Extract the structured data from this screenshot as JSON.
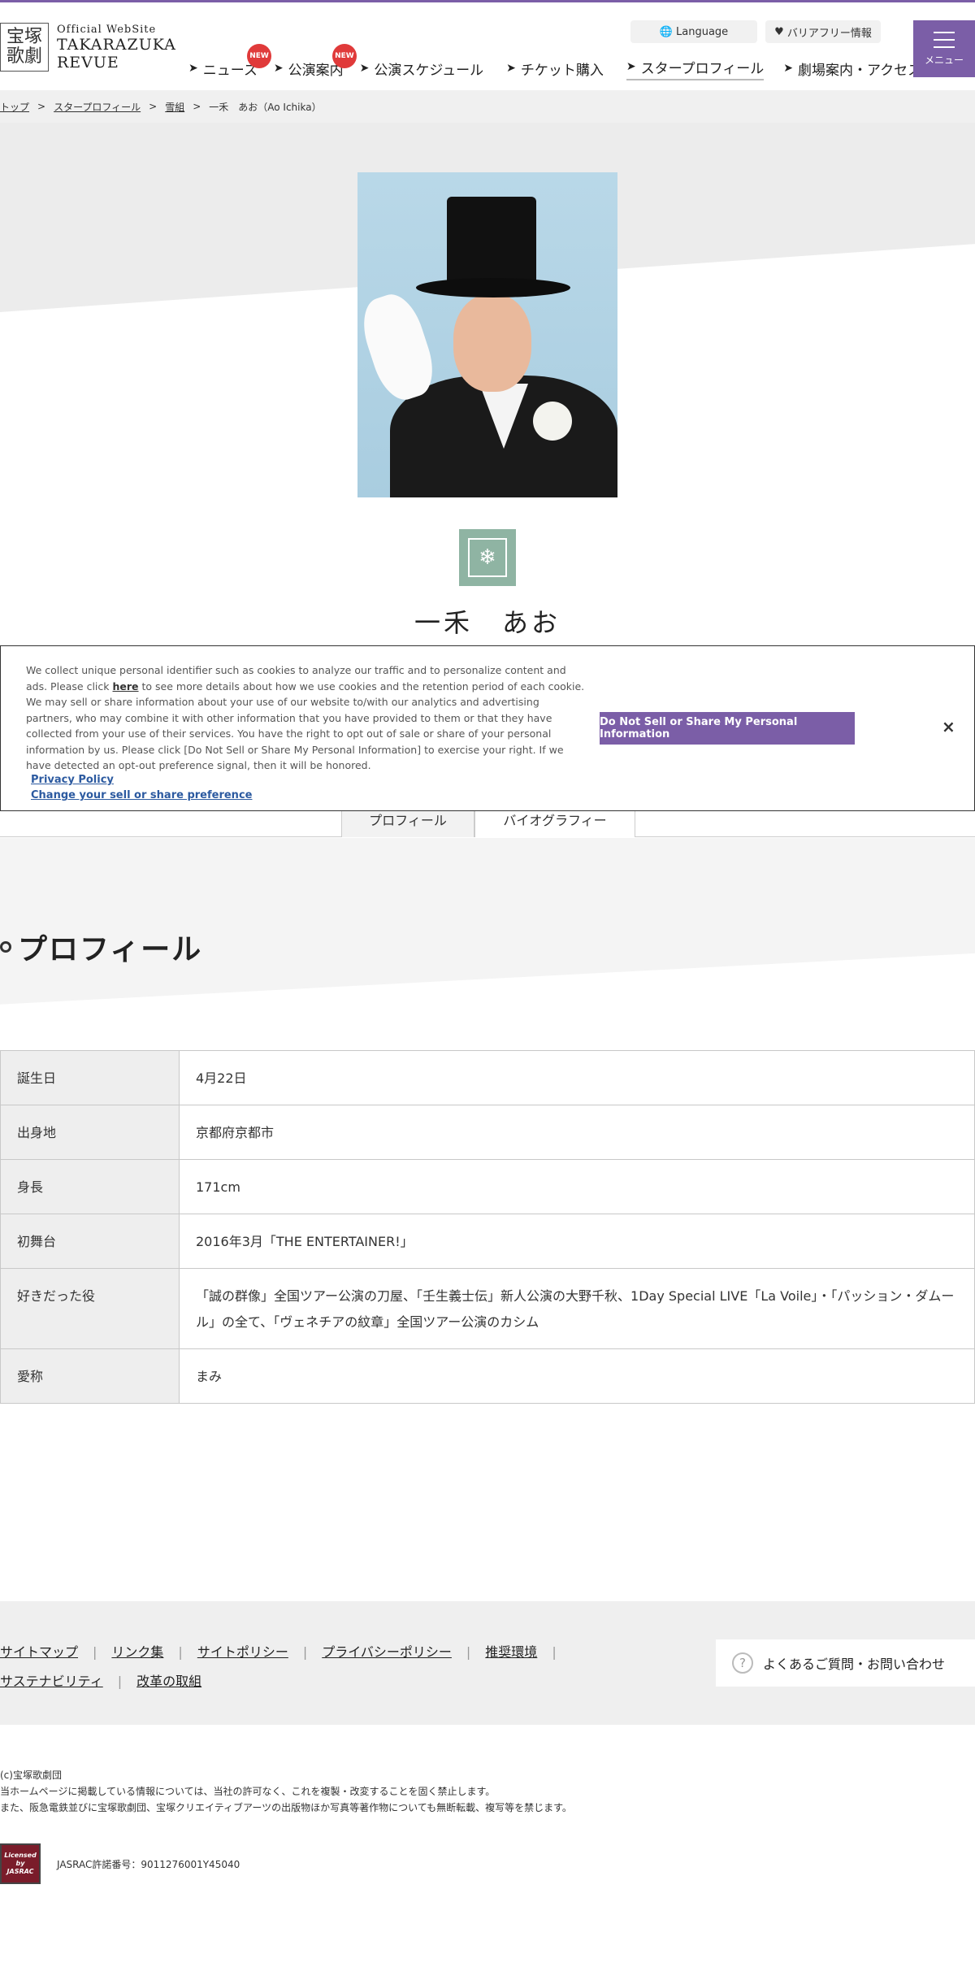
{
  "header": {
    "logo_kanji": "宝塚歌劇",
    "logo_sub": "Official WebSite",
    "logo_line1": "TAKARAZUKA",
    "logo_line2": "REVUE",
    "language_label": "Language",
    "barrier_free_label": "バリアフリー情報",
    "menu_label": "メニュー",
    "nav": [
      {
        "label": "ニュース",
        "badge": "NEW"
      },
      {
        "label": "公演案内",
        "badge": "NEW"
      },
      {
        "label": "公演スケジュール"
      },
      {
        "label": "チケット購入"
      },
      {
        "label": "スタープロフィール"
      },
      {
        "label": "劇場案内・アクセス"
      }
    ]
  },
  "breadcrumb": [
    "トップ",
    "スタープロフィール",
    "雪組",
    "一禾　あお（Ao Ichika）"
  ],
  "star": {
    "name": "一禾　あお"
  },
  "cookie": {
    "text_before": "We collect unique personal identifier such as cookies to analyze our traffic and to personalize content and ads. Please click ",
    "here": "here",
    "text_after": " to see more details about how we use cookies and the retention period of each cookie. We may sell or share information about your use of our website to/with our analytics and advertising partners, who may combine it with other information that you have provided to them or that they have collected from your use of their services. You have the right to opt out of sale or share of your personal information by us. Please click [Do Not Sell or Share My Personal Information] to exercise your right. If we have detected an opt-out preference signal, then it will be honored.",
    "privacy_link": "Privacy Policy",
    "preference_link": "Change your sell or share preference",
    "button": "Do Not Sell or Share My Personal Information",
    "close": "×"
  },
  "tabs": [
    "プロフィール",
    "バイオグラフィー"
  ],
  "section_title": "プロフィール",
  "profile": [
    {
      "key": "誕生日",
      "value": "4月22日"
    },
    {
      "key": "出身地",
      "value": "京都府京都市"
    },
    {
      "key": "身長",
      "value": "171cm"
    },
    {
      "key": "初舞台",
      "value": "2016年3月「THE ENTERTAINER!」"
    },
    {
      "key": "好きだった役",
      "value": "「誠の群像」全国ツアー公演の刀屋、「壬生義士伝」新人公演の大野千秋、1Day Special LIVE「La Voile」・「パッション・ダムール」の全て、「ヴェネチアの紋章」全国ツアー公演のカシム"
    },
    {
      "key": "愛称",
      "value": "まみ"
    }
  ],
  "footer": {
    "links": [
      "サイトマップ",
      "リンク集",
      "サイトポリシー",
      "プライバシーポリシー",
      "推奨環境",
      "サステナビリティ",
      "改革の取組"
    ],
    "faq": "よくあるご質問・お問い合わせ",
    "copyright": [
      "(c)宝塚歌劇団",
      "当ホームページに掲載している情報については、当社の許可なく、これを複製・改変することを固く禁止します。",
      "また、阪急電鉄並びに宝塚歌劇団、宝塚クリエイティブアーツの出版物ほか写真等著作物についても無断転載、複写等を禁じます。"
    ],
    "jasrac_logo": "Licensed by JASRAC",
    "jasrac": "JASRAC許諾番号：9011276001Y45040"
  }
}
